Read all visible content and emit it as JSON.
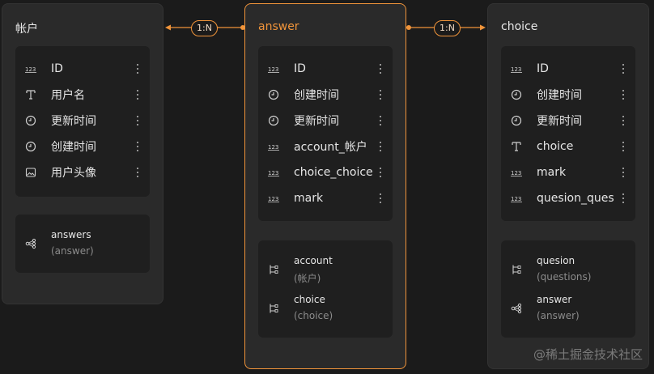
{
  "entities": {
    "account": {
      "title": "帐户",
      "fields": [
        {
          "icon": "number-icon",
          "label": "ID"
        },
        {
          "icon": "text-icon",
          "label": "用户名"
        },
        {
          "icon": "clock-icon",
          "label": "更新时间"
        },
        {
          "icon": "clock-icon",
          "label": "创建时间"
        },
        {
          "icon": "image-icon",
          "label": "用户头像"
        }
      ],
      "relations": [
        {
          "icon": "relation-many-icon",
          "name": "answers",
          "target": "(answer)"
        }
      ]
    },
    "answer": {
      "title": "answer",
      "fields": [
        {
          "icon": "number-icon",
          "label": "ID"
        },
        {
          "icon": "clock-icon",
          "label": "创建时间"
        },
        {
          "icon": "clock-icon",
          "label": "更新时间"
        },
        {
          "icon": "number-icon",
          "label": "account_帐户"
        },
        {
          "icon": "number-icon",
          "label": "choice_choice"
        },
        {
          "icon": "number-icon",
          "label": "mark"
        }
      ],
      "relations": [
        {
          "icon": "relation-one-icon",
          "name": "account",
          "target": "(帐户)"
        },
        {
          "icon": "relation-one-icon",
          "name": "choice",
          "target": "(choice)"
        }
      ]
    },
    "choice": {
      "title": "choice",
      "fields": [
        {
          "icon": "number-icon",
          "label": "ID"
        },
        {
          "icon": "clock-icon",
          "label": "创建时间"
        },
        {
          "icon": "clock-icon",
          "label": "更新时间"
        },
        {
          "icon": "text-icon",
          "label": "choice"
        },
        {
          "icon": "number-icon",
          "label": "mark"
        },
        {
          "icon": "number-icon",
          "label": "quesion_ques…"
        }
      ],
      "relations": [
        {
          "icon": "relation-one-icon",
          "name": "quesion",
          "target": "(questions)"
        },
        {
          "icon": "relation-many-icon",
          "name": "answer",
          "target": "(answer)"
        }
      ]
    }
  },
  "links": [
    {
      "label": "1:N"
    },
    {
      "label": "1:N"
    }
  ],
  "watermark": "@稀土掘金技术社区",
  "colors": {
    "accent": "#f0943a",
    "background": "#1b1b1b",
    "card": "#2a2a2a"
  }
}
